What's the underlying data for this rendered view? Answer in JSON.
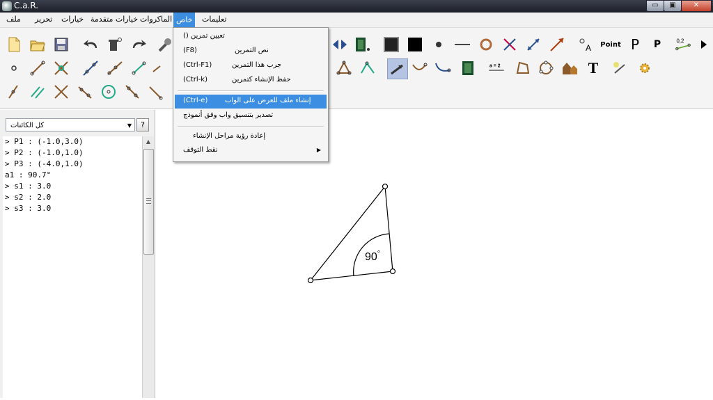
{
  "window": {
    "title": "C.a.R.",
    "min_label": "▭",
    "max_label": "▣",
    "close_label": "✕"
  },
  "menubar": {
    "items": [
      {
        "label": "ملف"
      },
      {
        "label": "تحرير"
      },
      {
        "label": "خيارات"
      },
      {
        "label": "خيارات متقدمة"
      },
      {
        "label": "الماكروات"
      },
      {
        "label": "خاص"
      },
      {
        "label": "تعليمات"
      }
    ]
  },
  "dropdown": {
    "items": [
      {
        "label": "() تعيين تمرين"
      },
      {
        "label": "نص التمرين",
        "shortcut": "(F8)"
      },
      {
        "label": "جرب هذا التمرين",
        "shortcut": "(Ctrl-F1)"
      },
      {
        "label": "حفظ الإنشاء كتمرين",
        "shortcut": "(Ctrl-k)"
      },
      {
        "label": "إنشاء ملف للعرض على الواب",
        "shortcut": "(Ctrl-e)"
      },
      {
        "label": "تصدير بتنسيق واب وفق أنموذج"
      },
      {
        "label": "إعادة رؤية مراحل الإنشاء"
      },
      {
        "label": "نقط التوقف",
        "arrow": "▶"
      }
    ]
  },
  "toolbar": {
    "text_tools": {
      "point_label": "Point",
      "p_large": "P",
      "p_bold": "P",
      "coord_label": "0,2",
      "a_label": "A",
      "eq_label": "a = 2",
      "text_tool": "T"
    }
  },
  "left_panel": {
    "filter": {
      "value": "كل الكائنات",
      "arrow": "▼"
    },
    "help_label": "?",
    "objects": [
      "> P1 : (-1.0,3.0)",
      "> P2 : (-1.0,1.0)",
      "> P3 : (-4.0,1.0)",
      "a1 : 90.7°",
      "> s1 : 3.0",
      "> s2 : 2.0",
      "> s3 : 3.0"
    ]
  },
  "canvas": {
    "angle_label": "90",
    "degree_symbol": "°"
  },
  "colors": {
    "highlight": "#3c8ee2",
    "title_bar": "#2a2e3a",
    "tool_selected": "#b6c4e3"
  }
}
